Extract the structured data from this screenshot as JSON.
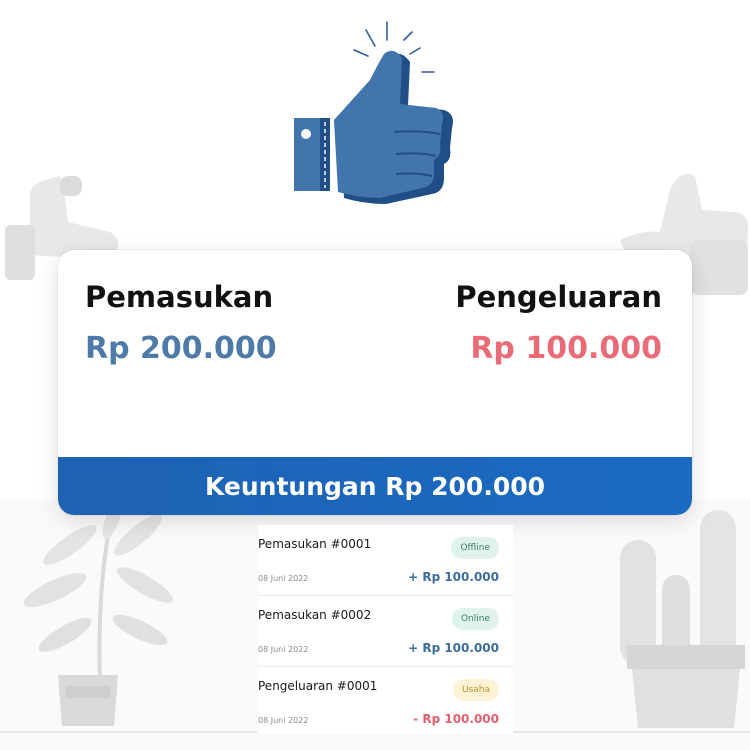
{
  "summary": {
    "income_label": "Pemasukan",
    "income_value": "Rp 200.000",
    "expense_label": "Pengeluaran",
    "expense_value": "Rp 100.000",
    "profit_text": "Keuntungan Rp 200.000"
  },
  "transactions": [
    {
      "title": "Pemasukan #0001",
      "badge": "Offline",
      "badge_color": "green",
      "date": "08 Juni 2022",
      "amount": "+ Rp 100.000",
      "amount_color": "plus"
    },
    {
      "title": "Pemasukan #0002",
      "badge": "Online",
      "badge_color": "green",
      "date": "08 Juni 2022",
      "amount": "+ Rp 100.000",
      "amount_color": "plus"
    },
    {
      "title": "Pengeluaran #0001",
      "badge": "Usaha",
      "badge_color": "yellow",
      "date": "08 Juni 2022",
      "amount": "- Rp 100.000",
      "amount_color": "minus"
    }
  ],
  "colors": {
    "primary_blue": "#1f62b3",
    "income_blue": "#4d7aa6",
    "expense_red": "#e96b78",
    "thumb_blue": "#4275ac"
  },
  "icons": {
    "hero": "thumbs-up-icon",
    "background": [
      "thumbs-up-icon",
      "plant-icon",
      "cactus-icon"
    ]
  }
}
